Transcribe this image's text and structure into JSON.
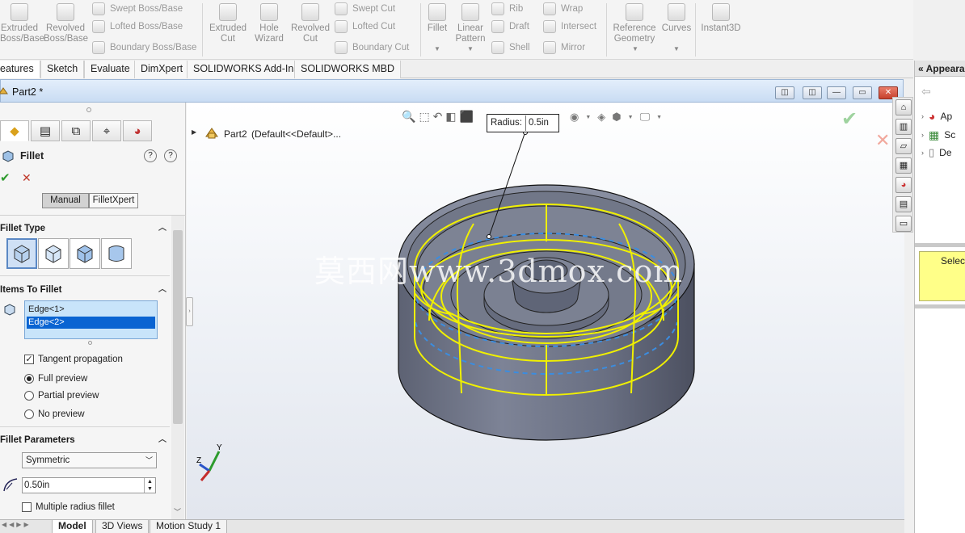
{
  "ribbon": {
    "big": [
      {
        "label": "Extruded\nBoss/Base"
      },
      {
        "label": "Revolved\nBoss/Base"
      },
      {
        "label": "Extruded\nCut"
      },
      {
        "label": "Hole\nWizard"
      },
      {
        "label": "Revolved\nCut"
      },
      {
        "label": "Fillet"
      },
      {
        "label": "Linear\nPattern"
      },
      {
        "label": "Reference\nGeometry"
      },
      {
        "label": "Curves"
      },
      {
        "label": "Instant3D"
      }
    ],
    "small": [
      {
        "label": "Swept Boss/Base"
      },
      {
        "label": "Lofted Boss/Base"
      },
      {
        "label": "Boundary Boss/Base"
      },
      {
        "label": "Swept Cut"
      },
      {
        "label": "Lofted Cut"
      },
      {
        "label": "Boundary Cut"
      },
      {
        "label": "Rib"
      },
      {
        "label": "Draft"
      },
      {
        "label": "Shell"
      },
      {
        "label": "Wrap"
      },
      {
        "label": "Intersect"
      },
      {
        "label": "Mirror"
      }
    ]
  },
  "tabs": [
    "eatures",
    "Sketch",
    "Evaluate",
    "DimXpert",
    "SOLIDWORKS Add-Ins",
    "SOLIDWORKS MBD"
  ],
  "doc": {
    "title": "Part2 *"
  },
  "pm": {
    "title": "Fillet",
    "manual": "Manual",
    "filletxpert": "FilletXpert",
    "fillet_type": "Fillet Type",
    "items_to_fillet": "Items To Fillet",
    "edges": [
      "Edge<1>",
      "Edge<2>"
    ],
    "tangent": "Tangent propagation",
    "full_preview": "Full preview",
    "partial_preview": "Partial preview",
    "no_preview": "No preview",
    "fillet_params": "Fillet Parameters",
    "symmetric": "Symmetric",
    "radius_value": "0.50in",
    "multiple_radius": "Multiple radius fillet"
  },
  "tree": {
    "part": "Part2",
    "config": "(Default<<Default>..."
  },
  "callout": {
    "label": "Radius:",
    "value": "0.5in"
  },
  "watermark": "莫西网www.3dmox.com",
  "bottom_tabs": [
    "Model",
    "3D Views",
    "Motion Study 1"
  ],
  "taskpane": {
    "title": "Appeara",
    "rows": [
      "Ap",
      "Sc",
      "De"
    ],
    "select": "Select"
  },
  "triad": {
    "y": "Y",
    "z": "Z"
  },
  "colors": {
    "highlight": "#ffff00",
    "model": "#6e7487",
    "edge_dash": "#3b8de0",
    "select_bg": "#ffff88"
  }
}
